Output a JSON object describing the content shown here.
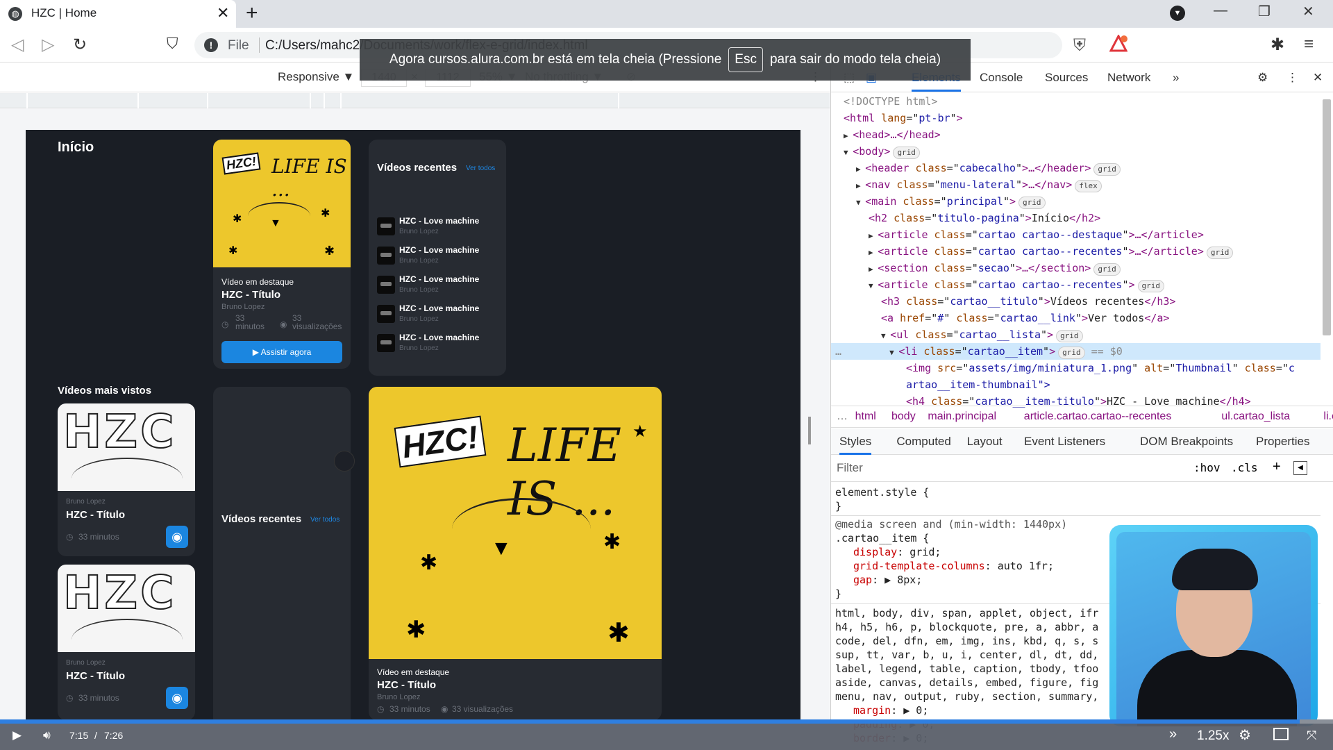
{
  "browser": {
    "tab_title": "HZC | Home",
    "tab_close": "✕",
    "new_tab": "+",
    "file_label": "File",
    "url": "C:/Users/mahc2/Documents/work/flex-e-grid/index.html",
    "profile_glyph": "▼"
  },
  "fullscreen_notice": {
    "before": "Agora cursos.alura.com.br está em tela cheia (Pressione",
    "key": "Esc",
    "after": "para sair do modo tela cheia)"
  },
  "device_toolbar": {
    "mode": "Responsive ▼",
    "width": "1440",
    "times": "×",
    "height": "1112",
    "zoom": "55% ▼",
    "throttling": "No throttling ▼"
  },
  "page": {
    "title": "Início",
    "featured": {
      "label": "Vídeo em destaque",
      "title": "HZC - Título",
      "author": "Bruno Lopez",
      "duration_num": "33",
      "duration_unit": "minutos",
      "views_num": "33",
      "views_unit": "visualizações",
      "button": "Assistir agora",
      "art_text": "LIFE IS ...",
      "art_tag": "HZC!"
    },
    "recent": {
      "title": "Vídeos recentes",
      "link": "Ver todos",
      "items": [
        {
          "title": "HZC - Love machine",
          "author": "Bruno Lopez"
        },
        {
          "title": "HZC - Love machine",
          "author": "Bruno Lopez"
        },
        {
          "title": "HZC - Love machine",
          "author": "Bruno Lopez"
        },
        {
          "title": "HZC - Love machine",
          "author": "Bruno Lopez"
        },
        {
          "title": "HZC - Love machine",
          "author": "Bruno Lopez"
        }
      ]
    },
    "most_viewed": {
      "title": "Vídeos mais vistos",
      "cards": [
        {
          "author": "Bruno Lopez",
          "title": "HZC - Título",
          "duration": "33 minutos",
          "art": "HZC"
        },
        {
          "author": "Bruno Lopez",
          "title": "HZC - Título",
          "duration": "33 minutos",
          "art": "HZC"
        }
      ]
    },
    "recent2": {
      "title": "Vídeos recentes",
      "link": "Ver todos"
    },
    "featured2": {
      "label": "Vídeo em destaque",
      "title": "HZC - Título",
      "author": "Bruno Lopez",
      "stats": "33 minutos",
      "views": "33 visualizações",
      "art_text": "LIFE IS ...",
      "art_tag": "HZC!"
    }
  },
  "devtools": {
    "tabs": [
      "Elements",
      "Console",
      "Sources",
      "Network",
      "»"
    ],
    "active_tab": "Elements",
    "dom": [
      {
        "indent": 0,
        "arrow": "",
        "html": "<!DOCTYPE html>",
        "kind": "comment"
      },
      {
        "indent": 0,
        "arrow": "",
        "tag": "html",
        "attrs": [
          [
            "lang",
            "pt-br"
          ]
        ],
        "tail": ""
      },
      {
        "indent": 0,
        "arrow": "▶",
        "tag": "head",
        "attrs": [],
        "tail": "…</head>"
      },
      {
        "indent": 0,
        "arrow": "▼",
        "tag": "body",
        "attrs": [],
        "tail": "",
        "badge": "grid"
      },
      {
        "indent": 1,
        "arrow": "▶",
        "tag": "header",
        "attrs": [
          [
            "class",
            "cabecalho"
          ]
        ],
        "tail": "…</header>",
        "badge": "grid"
      },
      {
        "indent": 1,
        "arrow": "▶",
        "tag": "nav",
        "attrs": [
          [
            "class",
            "menu-lateral"
          ]
        ],
        "tail": "…</nav>",
        "badge": "flex"
      },
      {
        "indent": 1,
        "arrow": "▼",
        "tag": "main",
        "attrs": [
          [
            "class",
            "principal"
          ]
        ],
        "tail": "",
        "badge": "grid"
      },
      {
        "indent": 2,
        "arrow": "",
        "tag": "h2",
        "attrs": [
          [
            "class",
            "titulo-pagina"
          ]
        ],
        "text": "Início",
        "tail": "</h2>"
      },
      {
        "indent": 2,
        "arrow": "▶",
        "tag": "article",
        "attrs": [
          [
            "class",
            "cartao cartao--destaque"
          ]
        ],
        "tail": "…</article>"
      },
      {
        "indent": 2,
        "arrow": "▶",
        "tag": "article",
        "attrs": [
          [
            "class",
            "cartao cartao--recentes"
          ]
        ],
        "tail": "…</article>",
        "badge": "grid"
      },
      {
        "indent": 2,
        "arrow": "▶",
        "tag": "section",
        "attrs": [
          [
            "class",
            "secao"
          ]
        ],
        "tail": "…</section>",
        "badge": "grid"
      },
      {
        "indent": 2,
        "arrow": "▼",
        "tag": "article",
        "attrs": [
          [
            "class",
            "cartao cartao--recentes"
          ]
        ],
        "tail": "",
        "badge": "grid"
      },
      {
        "indent": 3,
        "arrow": "",
        "tag": "h3",
        "attrs": [
          [
            "class",
            "cartao__titulo"
          ]
        ],
        "text": "Vídeos recentes",
        "tail": "</h3>"
      },
      {
        "indent": 3,
        "arrow": "",
        "tag": "a",
        "attrs": [
          [
            "href",
            "#"
          ],
          [
            "class",
            "cartao__link"
          ]
        ],
        "text": "Ver todos",
        "tail": "</a>"
      },
      {
        "indent": 3,
        "arrow": "▼",
        "tag": "ul",
        "attrs": [
          [
            "class",
            "cartao__lista"
          ]
        ],
        "tail": "",
        "badge": "grid"
      },
      {
        "indent": 4,
        "arrow": "▼",
        "tag": "li",
        "attrs": [
          [
            "class",
            "cartao__item"
          ]
        ],
        "tail": "",
        "badge": "grid",
        "selected": true,
        "eq": "== $0"
      },
      {
        "indent": 5,
        "arrow": "",
        "tag": "img",
        "attrs": [
          [
            "src",
            "assets/img/miniatura_1.png"
          ],
          [
            "alt",
            "Thumbnail"
          ],
          [
            "class",
            "c"
          ]
        ],
        "tail": "",
        "open": true
      },
      {
        "indent": 5,
        "arrow": "",
        "html": "artao__item-thumbnail\">",
        "kind": "cont"
      },
      {
        "indent": 5,
        "arrow": "",
        "tag": "h4",
        "attrs": [
          [
            "class",
            "cartao__item-titulo"
          ]
        ],
        "text": "HZC - Love machine",
        "tail": "</h4>"
      }
    ],
    "breadcrumbs": [
      "…",
      "html",
      "body",
      "main.principal",
      "article.cartao.cartao--recentes",
      "ul.cartao_lista",
      "li.ca",
      "…"
    ],
    "style_tabs": [
      "Styles",
      "Computed",
      "Layout",
      "Event Listeners",
      "DOM Breakpoints",
      "Properties",
      "»"
    ],
    "filter_placeholder": "Filter",
    "filter_tools": [
      ":hov",
      ".cls",
      "+"
    ],
    "styles": {
      "element_style_open": "element.style {",
      "close": "}",
      "media": "@media screen and (min-width: 1440px)",
      "selector": ".cartao__item {",
      "props": [
        {
          "name": "display",
          "value": "grid;"
        },
        {
          "name": "grid-template-columns",
          "value": "auto 1fr;"
        },
        {
          "name": "gap",
          "value": "▶ 8px;"
        }
      ],
      "reset_selectors": [
        "html, body, div, span, applet, object, ifr",
        "h4, h5, h6, p, blockquote, pre, a, abbr, a",
        "code, del, dfn, em, img, ins, kbd, q, s, s",
        "sup, tt, var, b, u, i, center, dl, dt, dd,",
        "label, legend, table, caption, tbody, tfoo",
        "aside, canvas, details, embed, figure, fig",
        "menu, nav, output, ruby, section, summary,"
      ],
      "reset_props": [
        {
          "name": "margin",
          "value": "▶ 0;"
        },
        {
          "name": "padding",
          "value": "▶ 0;"
        },
        {
          "name": "border",
          "value": "▶ 0;"
        }
      ]
    }
  },
  "video_player": {
    "current_time": "7:15",
    "separator": "/",
    "duration": "7:26",
    "progress_fraction": 0.975,
    "speed": "1.25x"
  }
}
